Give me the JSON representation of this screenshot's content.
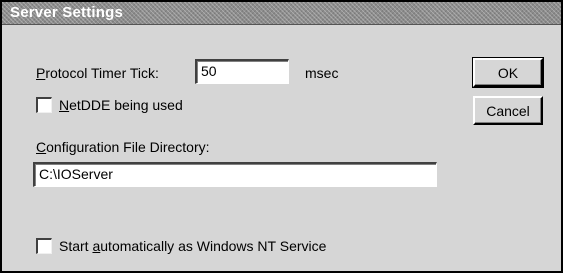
{
  "window": {
    "title": "Server Settings"
  },
  "protocol_timer": {
    "label_accel": "P",
    "label_rest": "rotocol Timer Tick:",
    "value": "50",
    "unit": "msec"
  },
  "netdde": {
    "label_accel": "N",
    "label_rest": "etDDE being used",
    "checked": false
  },
  "config_dir": {
    "label_accel": "C",
    "label_rest": "onfiguration File Directory:",
    "value": "C:\\IOServer"
  },
  "auto_start": {
    "label_pre": "Start ",
    "label_accel": "a",
    "label_rest": "utomatically as Windows NT Service",
    "checked": false
  },
  "buttons": {
    "ok_label": "OK",
    "cancel_label": "Cancel"
  }
}
